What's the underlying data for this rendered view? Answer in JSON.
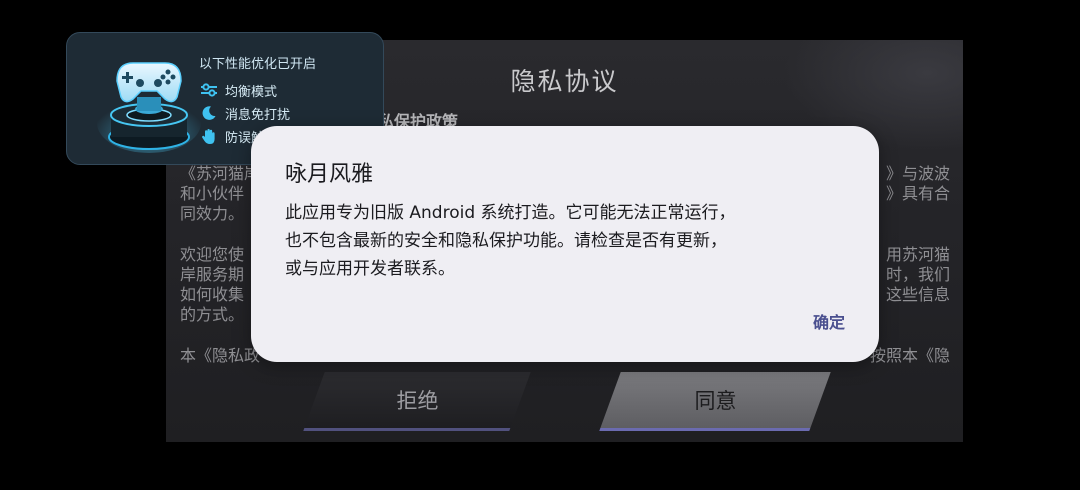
{
  "privacy_panel": {
    "title": "隐私协议",
    "subtitle": "隐私保护政策",
    "paragraph1": {
      "line1_left": "《苏河猫岸",
      "line1_right": "》与波波",
      "line2_left": "和小伙伴",
      "line2_right": "》具有合",
      "line3": "同效力。"
    },
    "paragraph2": {
      "line1_left": "欢迎您使",
      "line1_right": "用苏河猫",
      "line2_left": "岸服务期",
      "line2_right": "时，我们",
      "line3_left": "如何收集",
      "line3_right": "这些信息",
      "line4": "的方式。"
    },
    "paragraph3": {
      "line1_left": "本《隐私政",
      "line1_right": "按照本《隐"
    },
    "reject_label": "拒绝",
    "agree_label": "同意"
  },
  "perf_overlay": {
    "heading": "以下性能优化已开启",
    "items": [
      {
        "icon": "sliders-icon",
        "label": "均衡模式"
      },
      {
        "icon": "moon-icon",
        "label": "消息免打扰"
      },
      {
        "icon": "hand-icon",
        "label": "防误触"
      }
    ]
  },
  "dialog": {
    "title": "咏月风雅",
    "message_line1": "此应用专为旧版 Android 系统打造。它可能无法正常运行，",
    "message_line2": "也不包含最新的安全和隐私保护功能。请检查是否有更新，",
    "message_line3": "或与应用开发者联系。",
    "ok_label": "确定"
  },
  "colors": {
    "dialog_bg": "#efeef3",
    "accent_button": "#4a4f8f",
    "overlay_bg": "#1e2b35",
    "overlay_accent": "#3fc2f0"
  }
}
